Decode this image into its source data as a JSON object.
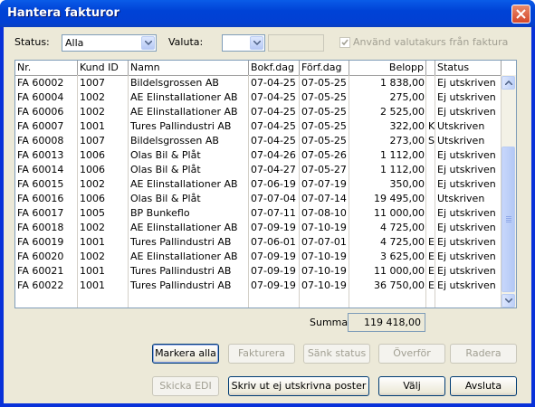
{
  "window": {
    "title": "Hantera fakturor"
  },
  "filters": {
    "status_label": "Status:",
    "status_value": "Alla",
    "valuta_label": "Valuta:",
    "valuta_value": "",
    "checkbox_label": "Använd valutakurs från faktura",
    "checkbox_checked": true
  },
  "table": {
    "columns": [
      "Nr.",
      "Kund ID",
      "Namn",
      "Bokf.dag",
      "Förf.dag",
      "Belopp",
      "Status"
    ],
    "rows": [
      [
        "FA 60002",
        "1007",
        "Bildelsgrossen AB",
        "07-04-25",
        "07-05-25",
        "1 838,00",
        "",
        "Ej utskriven"
      ],
      [
        "FA 60004",
        "1002",
        "AE Elinstallationer AB",
        "07-04-25",
        "07-05-25",
        "275,00",
        "",
        "Ej utskriven"
      ],
      [
        "FA 60006",
        "1002",
        "AE Elinstallationer AB",
        "07-04-25",
        "07-05-25",
        "2 525,00",
        "",
        "Ej utskriven"
      ],
      [
        "FA 60007",
        "1001",
        "Tures Pallindustri AB",
        "07-04-25",
        "07-05-25",
        "322,00",
        "K",
        "Utskriven"
      ],
      [
        "FA 60008",
        "1007",
        "Bildelsgrossen AB",
        "07-04-25",
        "07-05-25",
        "273,00",
        "S",
        "Utskriven"
      ],
      [
        "FA 60013",
        "1006",
        "Olas Bil & Plåt",
        "07-04-26",
        "07-05-26",
        "1 112,00",
        "",
        "Ej utskriven"
      ],
      [
        "FA 60014",
        "1006",
        "Olas Bil & Plåt",
        "07-04-27",
        "07-05-27",
        "1 112,00",
        "",
        "Ej utskriven"
      ],
      [
        "FA 60015",
        "1002",
        "AE Elinstallationer AB",
        "07-06-19",
        "07-07-19",
        "350,00",
        "",
        "Ej utskriven"
      ],
      [
        "FA 60016",
        "1006",
        "Olas Bil & Plåt",
        "07-07-04",
        "07-07-14",
        "19 495,00",
        "",
        "Utskriven"
      ],
      [
        "FA 60017",
        "1005",
        "BP Bunkeflo",
        "07-07-11",
        "07-08-10",
        "11 000,00",
        "",
        "Ej utskriven"
      ],
      [
        "FA 60018",
        "1002",
        "AE Elinstallationer AB",
        "07-09-19",
        "07-10-19",
        "4 725,00",
        "",
        "Ej utskriven"
      ],
      [
        "FA 60019",
        "1001",
        "Tures Pallindustri AB",
        "07-06-01",
        "07-07-01",
        "4 725,00",
        "E",
        "Ej utskriven"
      ],
      [
        "FA 60020",
        "1002",
        "AE Elinstallationer AB",
        "07-09-19",
        "07-10-19",
        "3 625,00",
        "E",
        "Ej utskriven"
      ],
      [
        "FA 60021",
        "1001",
        "Tures Pallindustri AB",
        "07-09-19",
        "07-10-19",
        "11 000,00",
        "E",
        "Ej utskriven"
      ],
      [
        "FA 60022",
        "1001",
        "Tures Pallindustri AB",
        "07-09-19",
        "07-10-19",
        "36 750,00",
        "E",
        "Ej utskriven"
      ]
    ]
  },
  "summary": {
    "label": "Summa:",
    "value": "119 418,00"
  },
  "buttons": {
    "markera_alla": "Markera alla",
    "fakturera": "Fakturera",
    "sank_status": "Sänk status",
    "overfor": "Överför",
    "radera": "Radera",
    "skicka_edi": "Skicka EDI",
    "skriv_ut": "Skriv ut ej utskrivna poster",
    "valj": "Välj",
    "avsluta": "Avsluta"
  }
}
